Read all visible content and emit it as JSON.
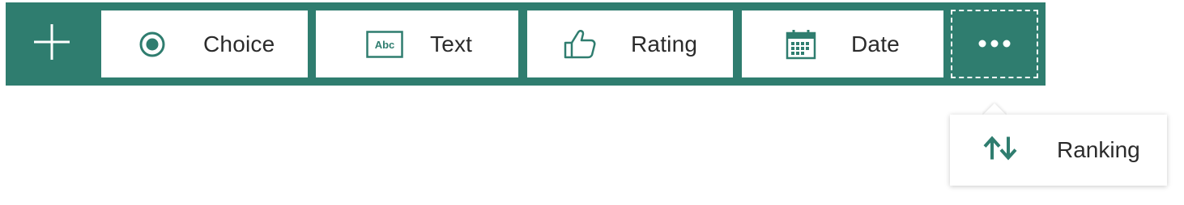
{
  "colors": {
    "accent": "#2f7d6f",
    "tile_background": "#ffffff",
    "text": "#2b2b2b"
  },
  "toolbar": {
    "add_icon": "plus-icon",
    "items": [
      {
        "label": "Choice",
        "icon": "radio-button-icon"
      },
      {
        "label": "Text",
        "icon": "text-abc-icon",
        "icon_text": "Abc"
      },
      {
        "label": "Rating",
        "icon": "thumbs-up-icon"
      },
      {
        "label": "Date",
        "icon": "calendar-icon"
      }
    ],
    "more_icon": "ellipsis-icon"
  },
  "more_menu": {
    "items": [
      {
        "label": "Ranking",
        "icon": "sort-arrows-icon"
      }
    ]
  }
}
